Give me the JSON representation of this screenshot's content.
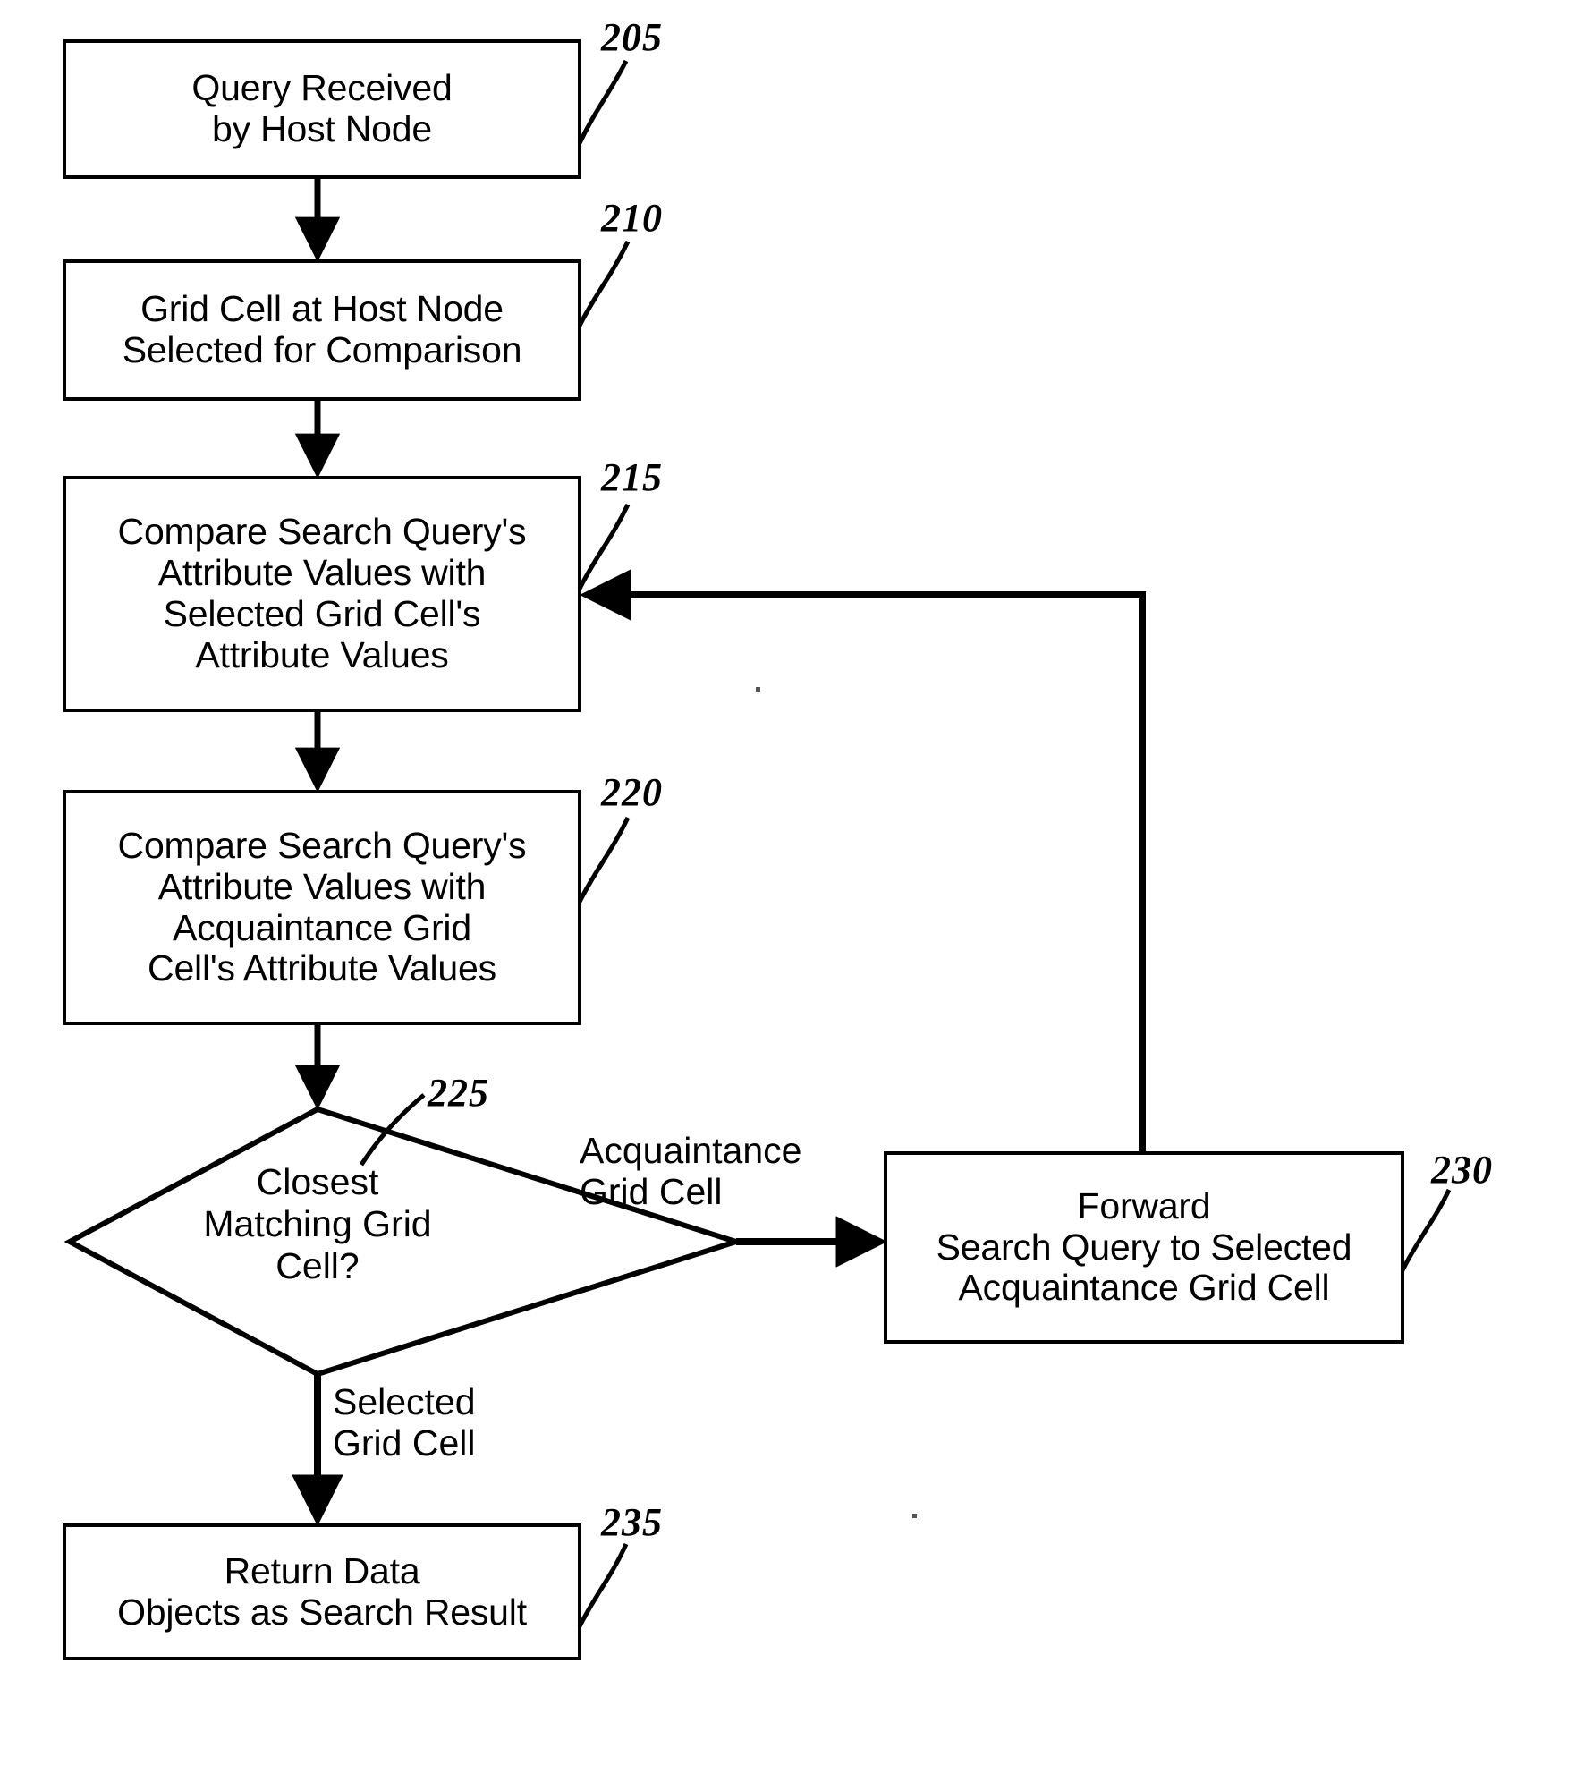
{
  "figure": {
    "type": "flowchart",
    "title": "Query processing flow at host node",
    "orientation": "vertical-with-feedback-loop"
  },
  "nodes": [
    {
      "id": "205",
      "ref": "205",
      "shape": "rectangle",
      "label": "Query Received\nby Host Node"
    },
    {
      "id": "210",
      "ref": "210",
      "shape": "rectangle",
      "label": "Grid Cell at Host Node\nSelected for Comparison"
    },
    {
      "id": "215",
      "ref": "215",
      "shape": "rectangle",
      "label": "Compare Search Query's\nAttribute Values with\nSelected Grid Cell's\nAttribute Values"
    },
    {
      "id": "220",
      "ref": "220",
      "shape": "rectangle",
      "label": "Compare Search Query's\nAttribute Values with\nAcquaintance Grid\nCell's Attribute Values"
    },
    {
      "id": "225",
      "ref": "225",
      "shape": "diamond",
      "label": "Closest\nMatching Grid\nCell?"
    },
    {
      "id": "230",
      "ref": "230",
      "shape": "rectangle",
      "label": "Forward\nSearch Query to Selected\nAcquaintance Grid Cell"
    },
    {
      "id": "235",
      "ref": "235",
      "shape": "rectangle",
      "label": "Return Data\nObjects as Search Result"
    }
  ],
  "edges": [
    {
      "from": "205",
      "to": "210",
      "label": ""
    },
    {
      "from": "210",
      "to": "215",
      "label": ""
    },
    {
      "from": "215",
      "to": "220",
      "label": ""
    },
    {
      "from": "220",
      "to": "225",
      "label": ""
    },
    {
      "from": "225",
      "to": "230",
      "label": "Acquaintance\nGrid Cell"
    },
    {
      "from": "225",
      "to": "235",
      "label": "Selected\nGrid Cell"
    },
    {
      "from": "230",
      "to": "215",
      "label": ""
    }
  ],
  "edge_labels": {
    "acquaintance_branch": "Acquaintance\nGrid Cell",
    "selected_branch": "Selected\nGrid Cell"
  },
  "colors": {
    "stroke": "#000000",
    "fill": "#ffffff",
    "text": "#000000"
  }
}
